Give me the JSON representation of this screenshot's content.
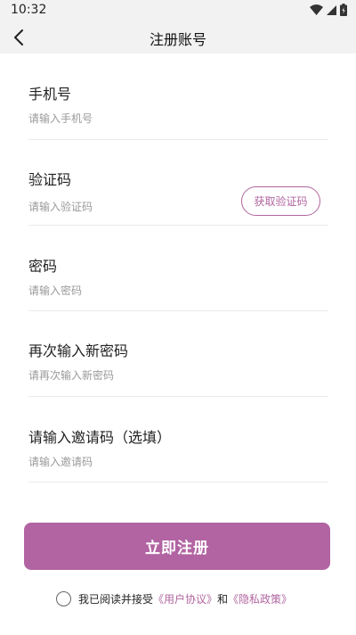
{
  "status": {
    "time": "10:32",
    "icons": [
      "wifi-icon",
      "signal-icon",
      "battery-icon"
    ]
  },
  "nav": {
    "title": "注册账号",
    "back_icon": "chevron-left-icon"
  },
  "form": {
    "phone": {
      "label": "手机号",
      "placeholder": "请输入手机号"
    },
    "code": {
      "label": "验证码",
      "placeholder": "请输入验证码",
      "button": "获取验证码"
    },
    "password": {
      "label": "密码",
      "placeholder": "请输入密码"
    },
    "confirm": {
      "label": "再次输入新密码",
      "placeholder": "请再次输入新密码"
    },
    "invite": {
      "label": "请输入邀请码（选填）",
      "placeholder": "请输入邀请码"
    }
  },
  "submit": {
    "label": "立即注册"
  },
  "agreement": {
    "prefix": "我已阅读并接受",
    "user_agreement": "《用户协议》",
    "and": "和",
    "privacy_policy": "《隐私政策》",
    "checked": false
  },
  "colors": {
    "accent": "#b264a2",
    "nav_background": "#f2f2f2"
  }
}
